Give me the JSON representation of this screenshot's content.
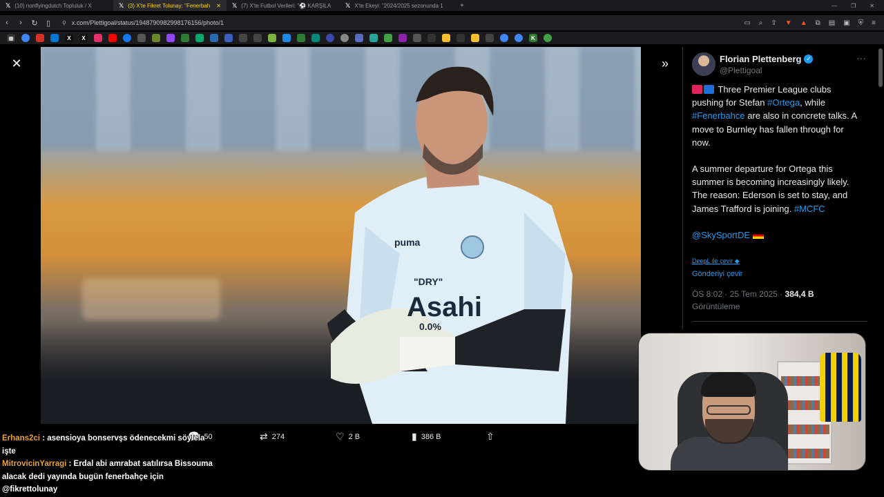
{
  "browser": {
    "tabs": [
      {
        "title": "(10) nonflyingdutch Topluluk / X",
        "active": false
      },
      {
        "title": "(3) X'te Fikret Tolunay: \"Fenerbah",
        "active": true
      },
      {
        "title": "(7) X'te Futbol Verileri: \"⚽ KARŞILA",
        "active": false
      },
      {
        "title": "X'te Ekeyi: \"2024/2025 sezonunda 1",
        "active": false
      }
    ],
    "url": "x.com/Plettigoal/status/1948790982998176156/photo/1"
  },
  "tweet": {
    "author_name": "Florian Plettenberg",
    "handle": "@Plettigoal",
    "p1_pre": "Three Premier League clubs pushing for Stefan ",
    "p1_tag1": "#Ortega",
    "p1_mid": ", while ",
    "p1_tag2": "#Fenerbahce",
    "p1_post": " are also in concrete talks. A move to Burnley has fallen through for now.",
    "p2_text": "A summer departure for Ortega this summer is becoming increasingly likely. The reason: Ederson is set to stay, and James Trafford is joining. ",
    "p2_tag": "#MCFC",
    "mention": "@SkySportDE",
    "deepl": "DeepL ile çevir",
    "translate": "Gönderiyi çevir",
    "timestamp": "ÖS 8:02 · 25 Tem 2025 · ",
    "views_count": "384,4 B",
    "views_label": "Görüntüleme"
  },
  "media_actions": {
    "reply_count": "50",
    "retweet_count": "274",
    "like_count": "2 B",
    "view_count": "386 B"
  },
  "chat": [
    {
      "user": "Erhans2ci",
      "message": ": asensioya bonservşs ödenecekmi söylela işte"
    },
    {
      "user": "MitrovicinYarragi",
      "message": ": Erdal abi amrabat satılırsa Bissouma alacak dedi yayında bugün fenerbahçe için @fikrettolunay"
    }
  ],
  "colors": {
    "link": "#1d9bf0",
    "chat_user": "#e6a23c",
    "verified": "#1d9bf0"
  }
}
